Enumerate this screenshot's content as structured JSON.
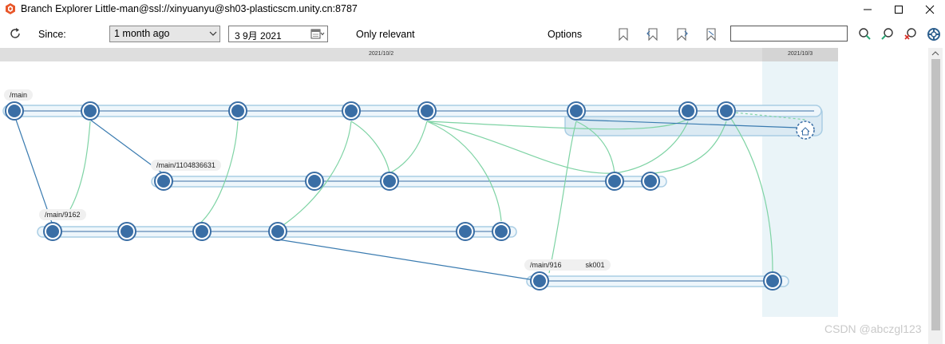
{
  "window": {
    "title": "Branch Explorer Little-man@ssl://xinyuanyu@sh03-plasticscm.unity.cn:8787"
  },
  "toolbar": {
    "since_label": "Since:",
    "since_value": "1 month ago",
    "date_value": "3  9月  2021",
    "only_relevant": "Only relevant",
    "options": "Options",
    "search_placeholder": ""
  },
  "timeline": {
    "dates": [
      "2021/10/2",
      "2021/10/3"
    ]
  },
  "branches": {
    "main": "/main",
    "b1": "/main/1104836631",
    "b2": "/main/9162",
    "b3": "/main/916",
    "b3_tail": "sk001"
  },
  "icons": {
    "app": "plastic-scm-logo-icon",
    "refresh": "refresh-icon",
    "calendar": "calendar-icon",
    "help": "help-lifebuoy-icon"
  },
  "colors": {
    "changeset": "#3a6ea5",
    "branch_line": "#a9cde4",
    "merge_link": "#7ed3a4",
    "parent_link": "#3a7bb0",
    "today_band": "#eaf4f8"
  },
  "watermark": "CSDN @abczgl123"
}
